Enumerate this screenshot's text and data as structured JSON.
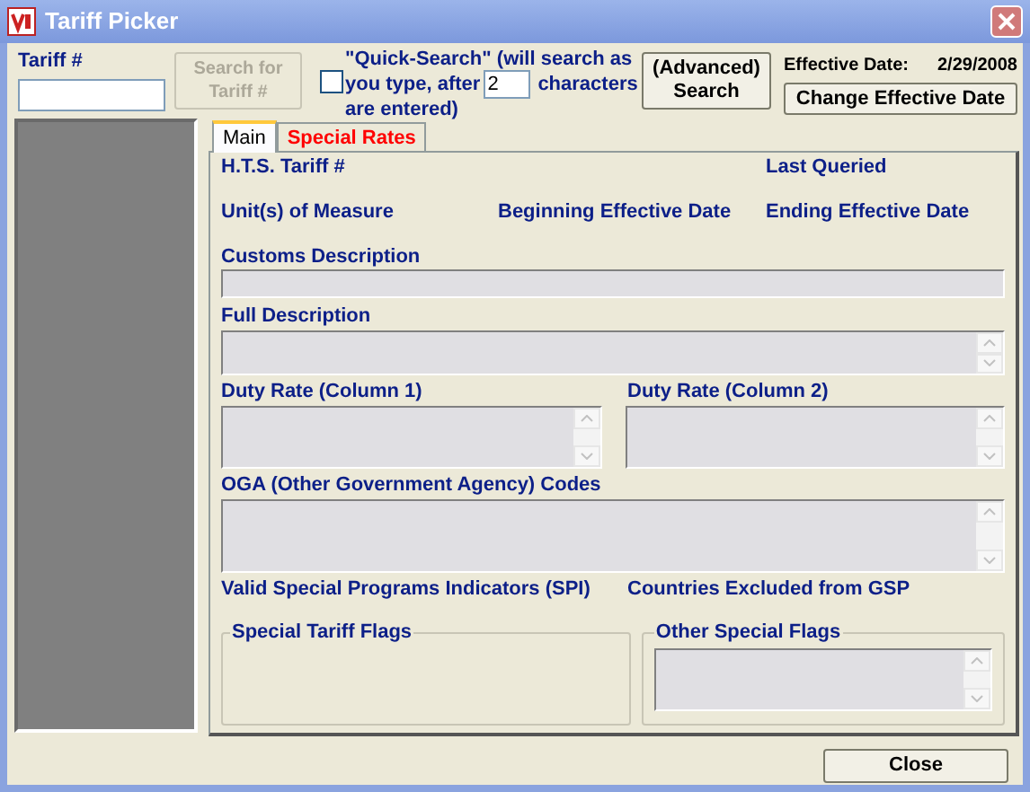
{
  "window": {
    "title": "Tariff Picker"
  },
  "tariff_field": {
    "label": "Tariff #"
  },
  "search_button": {
    "label": "Search for Tariff #",
    "disabled": true
  },
  "quick_search": {
    "checked": false,
    "line_1": "\"Quick-Search\" (will search as",
    "line_2_before": "you type, after",
    "value": "2",
    "line_2_after": "characters",
    "line_3": "are entered)"
  },
  "advanced_search_button": {
    "label": "(Advanced) Search"
  },
  "effective_date": {
    "label": "Effective Date:",
    "value": "2/29/2008"
  },
  "change_date_button": {
    "label": "Change Effective Date"
  },
  "tabs": [
    {
      "label": "Main",
      "selected": true,
      "color": "#000000"
    },
    {
      "label": "Special Rates",
      "selected": false,
      "color": "#ff0000"
    }
  ],
  "details": {
    "hts_tariff": "H.T.S. Tariff #",
    "last_queried": "Last Queried",
    "units": "Unit(s) of Measure",
    "beginning_date": "Beginning Effective Date",
    "ending_date": "Ending Effective Date",
    "customs_description": "Customs Description",
    "full_description": "Full Description",
    "duty_rate_1": "Duty Rate (Column 1)",
    "duty_rate_2": "Duty Rate (Column 2)",
    "oga_codes": "OGA (Other Government Agency) Codes",
    "spi": "Valid Special Programs Indicators (SPI)",
    "countries_excluded": "Countries Excluded from GSP",
    "special_tariff_flags": "Special Tariff Flags",
    "other_special_flags": "Other Special Flags"
  },
  "close_button": {
    "label": "Close"
  }
}
